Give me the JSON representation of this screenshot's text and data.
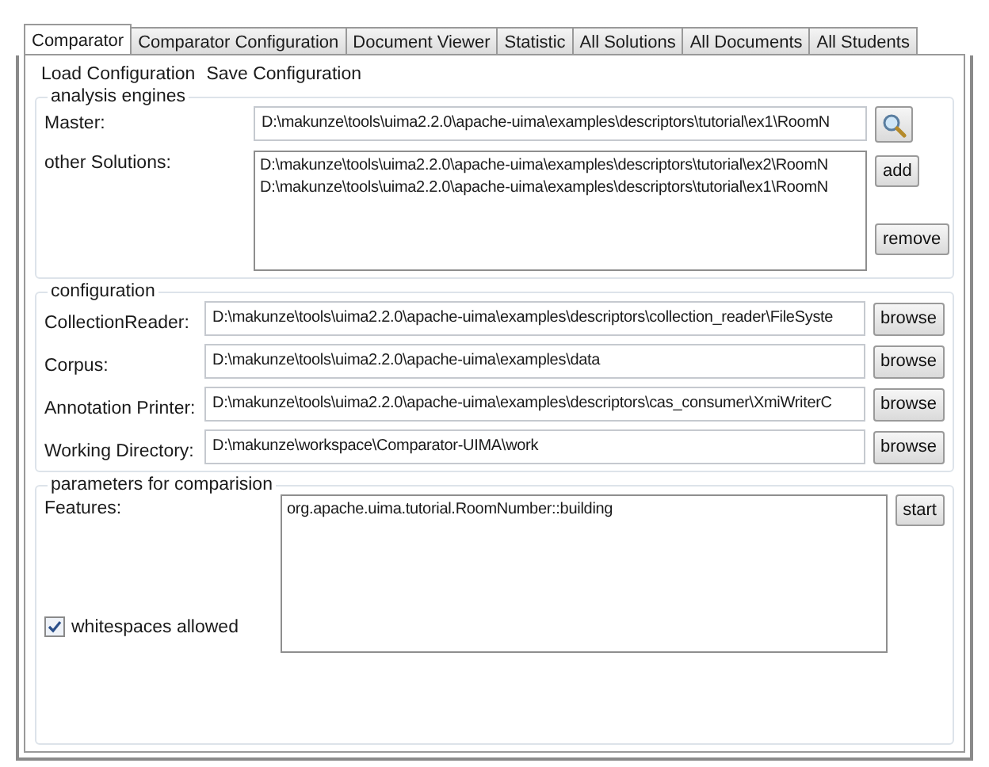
{
  "tabs": [
    {
      "label": "Comparator",
      "selected": true
    },
    {
      "label": "Comparator Configuration",
      "selected": false
    },
    {
      "label": "Document Viewer",
      "selected": false
    },
    {
      "label": "Statistic",
      "selected": false
    },
    {
      "label": "All Solutions",
      "selected": false
    },
    {
      "label": "All Documents",
      "selected": false
    },
    {
      "label": "All Students",
      "selected": false
    }
  ],
  "menu": [
    "Load Configuration",
    "Save Configuration"
  ],
  "analysis_engines": {
    "title": "analysis engines",
    "master_label": "Master:",
    "master_value": "D:\\makunze\\tools\\uima2.2.0\\apache-uima\\examples\\descriptors\\tutorial\\ex1\\RoomN",
    "other_label": "other Solutions:",
    "other_items": [
      "D:\\makunze\\tools\\uima2.2.0\\apache-uima\\examples\\descriptors\\tutorial\\ex2\\RoomN",
      "D:\\makunze\\tools\\uima2.2.0\\apache-uima\\examples\\descriptors\\tutorial\\ex1\\RoomN"
    ],
    "add_button": "add",
    "remove_button": "remove"
  },
  "configuration": {
    "title": "configuration",
    "rows": [
      {
        "label": "CollectionReader:",
        "value": "D:\\makunze\\tools\\uima2.2.0\\apache-uima\\examples\\descriptors\\collection_reader\\FileSyste",
        "button": "browse"
      },
      {
        "label": "Corpus:",
        "value": "D:\\makunze\\tools\\uima2.2.0\\apache-uima\\examples\\data",
        "button": "browse"
      },
      {
        "label": "Annotation Printer:",
        "value": "D:\\makunze\\tools\\uima2.2.0\\apache-uima\\examples\\descriptors\\cas_consumer\\XmiWriterC",
        "button": "browse"
      },
      {
        "label": "Working Directory:",
        "value": "D:\\makunze\\workspace\\Comparator-UIMA\\work",
        "button": "browse"
      }
    ]
  },
  "parameters": {
    "title": "parameters for comparision",
    "features_label": "Features:",
    "features_value": "org.apache.uima.tutorial.RoomNumber::building",
    "whitespaces": {
      "label": "whitespaces allowed",
      "checked": true
    },
    "start_button": "start"
  }
}
